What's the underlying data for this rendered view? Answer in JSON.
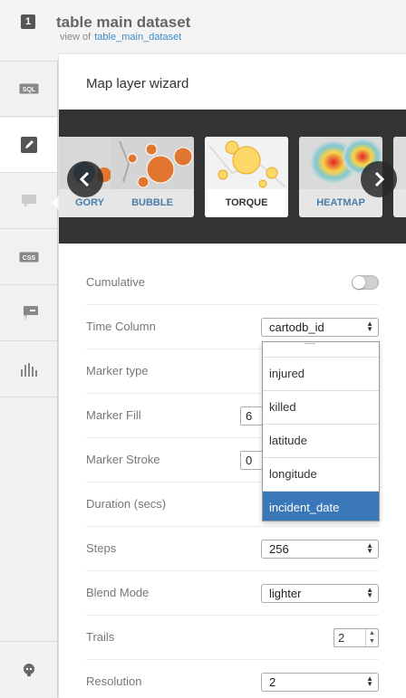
{
  "header": {
    "layer_number": "1",
    "title": "table main dataset",
    "view_of_label": "view of",
    "view_of_link": "table_main_dataset"
  },
  "sidebar": {
    "items": [
      {
        "name": "sql",
        "label": "SQL"
      },
      {
        "name": "wizard",
        "label": ""
      },
      {
        "name": "infowindow",
        "label": ""
      },
      {
        "name": "css",
        "label": "CSS"
      },
      {
        "name": "legend",
        "label": ""
      },
      {
        "name": "filters",
        "label": ""
      }
    ]
  },
  "wizard": {
    "title": "Map layer wizard",
    "cards": [
      {
        "label": "GORY"
      },
      {
        "label": "BUBBLE"
      },
      {
        "label": "TORQUE"
      },
      {
        "label": "HEATMAP"
      }
    ],
    "selected_card": "TORQUE"
  },
  "form": {
    "cumulative": {
      "label": "Cumulative",
      "on": false
    },
    "time_column": {
      "label": "Time Column",
      "value": "cartodb_id"
    },
    "marker_type": {
      "label": "Marker type"
    },
    "marker_fill": {
      "label": "Marker Fill",
      "value": "6"
    },
    "marker_stroke": {
      "label": "Marker Stroke",
      "value": "0"
    },
    "duration": {
      "label": "Duration (secs)"
    },
    "steps": {
      "label": "Steps",
      "value": "256"
    },
    "blend_mode": {
      "label": "Blend Mode",
      "value": "lighter"
    },
    "trails": {
      "label": "Trails",
      "value": "2"
    },
    "resolution": {
      "label": "Resolution",
      "value": "2"
    }
  },
  "dropdown": {
    "options": [
      "injured",
      "killed",
      "latitude",
      "longitude",
      "incident_date"
    ],
    "highlighted": "incident_date"
  },
  "colors": {
    "accent": "#3977b8",
    "link": "#3b8ac9",
    "carousel_bg": "#333333"
  }
}
